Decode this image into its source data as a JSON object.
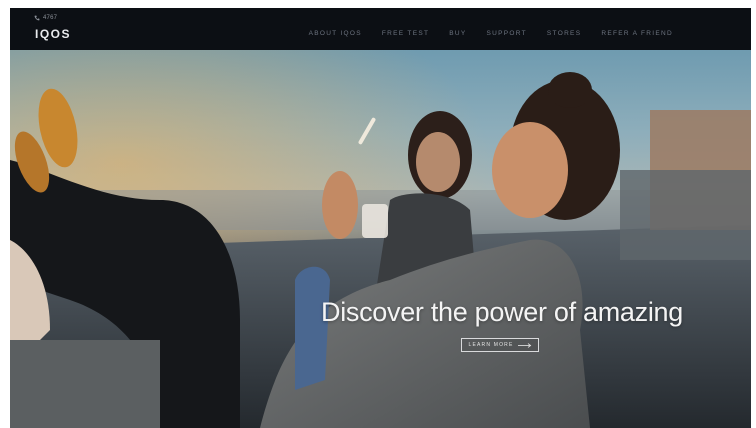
{
  "header": {
    "phone": "4767",
    "logo": "IQOS",
    "nav": [
      "ABOUT IQOS",
      "FREE TEST",
      "BUY",
      "SUPPORT",
      "STORES",
      "REFER A FRIEND"
    ]
  },
  "hero": {
    "headline": "Discover the power of amazing",
    "cta_label": "LEARN MORE"
  },
  "colors": {
    "nav_background": "#0c0f14",
    "nav_text": "#6d7480",
    "headline_text": "#f4f4f4"
  },
  "icons": {
    "phone": "phone-icon",
    "cta_arrow": "arrow-right-icon"
  }
}
